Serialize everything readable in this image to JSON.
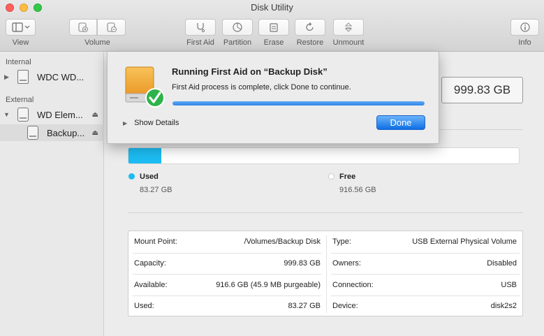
{
  "window": {
    "title": "Disk Utility"
  },
  "toolbar": {
    "view_label": "View",
    "volume_label": "Volume",
    "first_aid_label": "First Aid",
    "partition_label": "Partition",
    "erase_label": "Erase",
    "restore_label": "Restore",
    "unmount_label": "Unmount",
    "info_label": "Info"
  },
  "sidebar": {
    "internal_header": "Internal",
    "external_header": "External",
    "items": [
      {
        "label": "WDC WD...",
        "icon": "internal-disk-icon"
      },
      {
        "label": "WD Elem...",
        "icon": "external-disk-icon"
      },
      {
        "label": "Backup...",
        "icon": "volume-icon"
      }
    ]
  },
  "dialog": {
    "title": "Running First Aid on “Backup Disk”",
    "message": "First Aid process is complete, click Done to continue.",
    "progress": 1.0,
    "show_details_label": "Show Details",
    "done_label": "Done"
  },
  "volume": {
    "capacity_display": "999.83 GB",
    "used_fraction": 0.0833,
    "used_label": "Used",
    "used_value": "83.27 GB",
    "free_label": "Free",
    "free_value": "916.56 GB",
    "used_color": "#1cbcf2"
  },
  "info": {
    "left": [
      {
        "key": "Mount Point:",
        "value": "/Volumes/Backup Disk"
      },
      {
        "key": "Capacity:",
        "value": "999.83 GB"
      },
      {
        "key": "Available:",
        "value": "916.6 GB (45.9 MB purgeable)"
      },
      {
        "key": "Used:",
        "value": "83.27 GB"
      }
    ],
    "right": [
      {
        "key": "Type:",
        "value": "USB External Physical Volume"
      },
      {
        "key": "Owners:",
        "value": "Disabled"
      },
      {
        "key": "Connection:",
        "value": "USB"
      },
      {
        "key": "Device:",
        "value": "disk2s2"
      }
    ]
  }
}
